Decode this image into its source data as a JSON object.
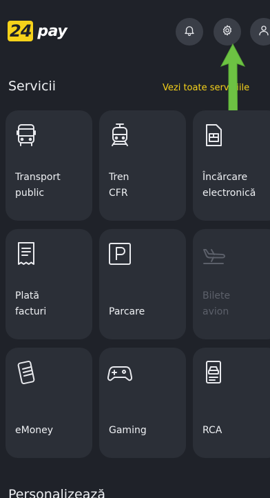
{
  "header": {
    "logo_number": "24",
    "logo_text": "pay"
  },
  "services": {
    "title": "Servicii",
    "see_all": "Vezi toate serviciile",
    "tiles": [
      {
        "line1": "Transport",
        "line2": "public",
        "icon": "bus-icon"
      },
      {
        "line1": "Tren",
        "line2": "CFR",
        "icon": "train-icon"
      },
      {
        "line1": "Încărcare",
        "line2": "electronică",
        "icon": "sim-card-icon"
      },
      {
        "line1": "Plată",
        "line2": "facturi",
        "icon": "receipt-icon"
      },
      {
        "line1": "",
        "line2": "Parcare",
        "icon": "parking-icon"
      },
      {
        "line1": "Bilete",
        "line2": "avion",
        "icon": "airplane-icon"
      },
      {
        "line1": "",
        "line2": "eMoney",
        "icon": "phone-money-icon"
      },
      {
        "line1": "",
        "line2": "Gaming",
        "icon": "gamepad-icon"
      },
      {
        "line1": "",
        "line2": "RCA",
        "icon": "car-document-icon"
      }
    ]
  },
  "personalize": {
    "title": "Personalizează"
  },
  "colors": {
    "background": "#1f2229",
    "tile": "#2b2f37",
    "accent": "#f6d21a",
    "annotation_arrow": "#6dc243"
  }
}
